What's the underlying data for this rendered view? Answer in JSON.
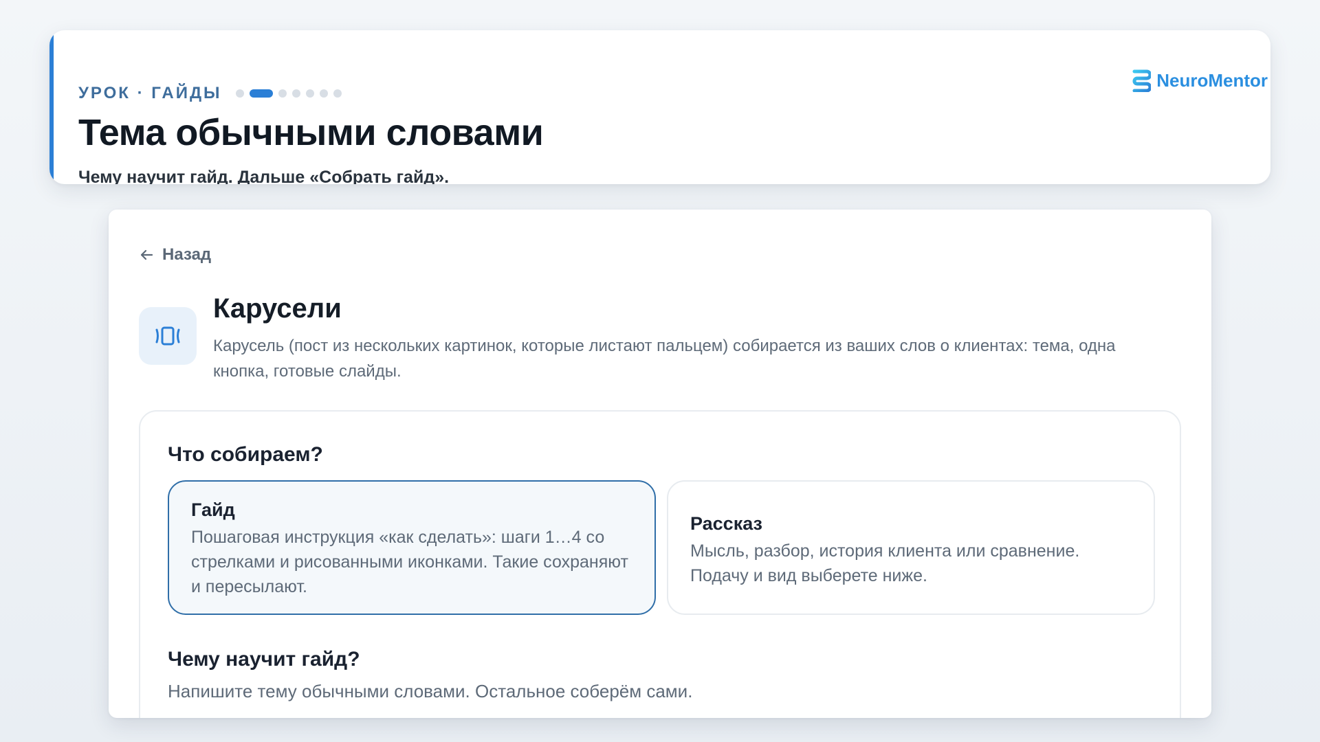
{
  "header": {
    "eyebrow": "УРОК · ГАЙДЫ",
    "progress": {
      "total_steps": 7,
      "current_step": 2
    },
    "title": "Тема обычными словами",
    "subtitle": "Чему научит гайд. Дальше «Собрать гайд».",
    "brand_name": "NeuroMentor",
    "accent_color": "#2b7fd6"
  },
  "panel": {
    "back_label": "Назад",
    "section_icon": "carousel-icon",
    "section_title": "Карусели",
    "section_desc": "Карусель (пост из нескольких картинок, которые листают пальцем) собирается из ваших слов о клиентах: тема, одна кнопка, готовые слайды.",
    "question_what": "Что собираем?",
    "options": [
      {
        "title": "Гайд",
        "desc": "Пошаговая инструкция «как сделать»: шаги 1…4 со стрелками и рисованными иконками. Такие сохраняют и пересылают.",
        "selected": true
      },
      {
        "title": "Рассказ",
        "desc": "Мысль, разбор, история клиента или сравнение. Подачу и вид выберете ниже.",
        "selected": false
      }
    ],
    "question_topic": "Чему научит гайд?",
    "topic_hint": "Напишите тему обычными словами. Остальное соберём сами."
  }
}
